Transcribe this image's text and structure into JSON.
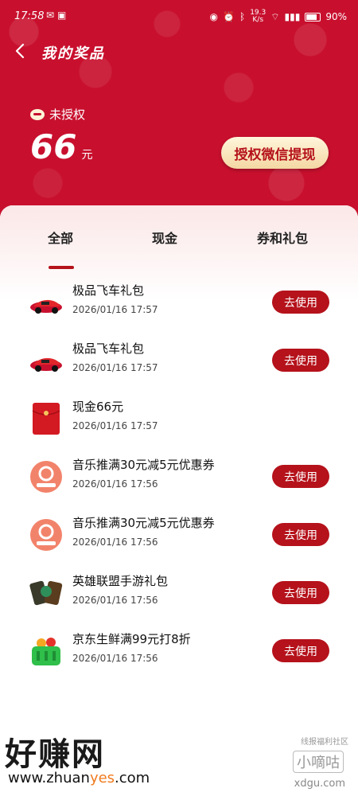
{
  "status_bar": {
    "time": "17:58",
    "net_speed_top": "19.3",
    "net_speed_bottom": "K/s",
    "battery": "90%"
  },
  "nav": {
    "title": "我的奖品"
  },
  "account": {
    "auth_status": "未授权",
    "amount": "66",
    "unit": "元",
    "withdraw_label": "授权微信提现"
  },
  "tabs": [
    "全部",
    "现金",
    "券和礼包"
  ],
  "items": [
    {
      "title": "极品飞车礼包",
      "time": "2026/01/16 17:57",
      "action": "去使用",
      "icon": "race-car-icon"
    },
    {
      "title": "极品飞车礼包",
      "time": "2026/01/16 17:57",
      "action": "去使用",
      "icon": "race-car-icon"
    },
    {
      "title": "现金66元",
      "time": "2026/01/16 17:57",
      "action": "",
      "icon": "red-envelope-icon"
    },
    {
      "title": "音乐推满30元减5元优惠券",
      "time": "2026/01/16 17:56",
      "action": "去使用",
      "icon": "music-coupon-icon"
    },
    {
      "title": "音乐推满30元减5元优惠券",
      "time": "2026/01/16 17:56",
      "action": "去使用",
      "icon": "music-coupon-icon"
    },
    {
      "title": "英雄联盟手游礼包",
      "time": "2026/01/16 17:56",
      "action": "去使用",
      "icon": "game-cards-icon"
    },
    {
      "title": "京东生鲜满99元打8折",
      "time": "2026/01/16 17:56",
      "action": "去使用",
      "icon": "grocery-basket-icon"
    }
  ],
  "watermark": {
    "brand": "好赚网",
    "url_prefix": "www.zhuan",
    "url_highlight": "yes",
    "url_suffix": ".com",
    "small_top": "线报福利社区",
    "small_mid": "小嘀咕",
    "small_bottom": "xdgu.com"
  },
  "colors": {
    "primary_red": "#c8102e",
    "button_red": "#b5121b",
    "gold": "#f4d7a3"
  }
}
